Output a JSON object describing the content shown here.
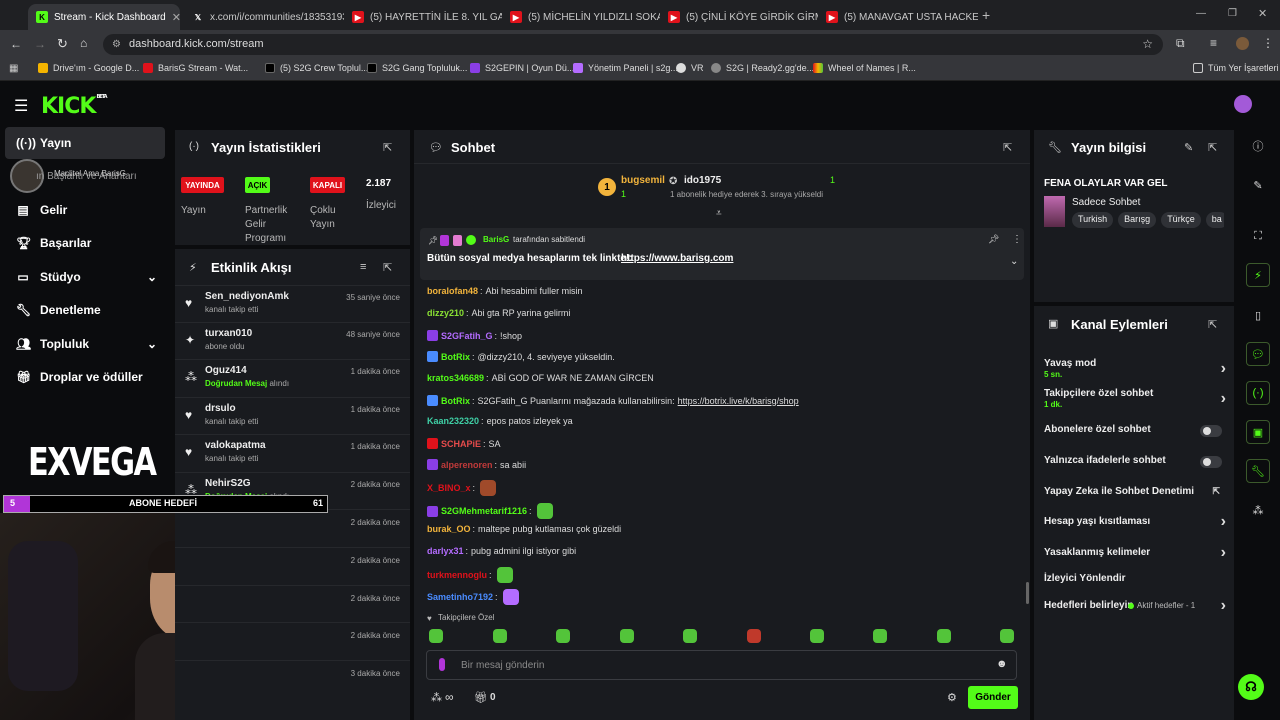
{
  "browser": {
    "tabs": [
      {
        "label": "Stream - Kick Dashboard",
        "icon": "kick"
      },
      {
        "label": "x.com/i/communities/18353193",
        "icon": "x"
      },
      {
        "label": "(5) HAYRETTİN İLE 8. YIL GALAS",
        "icon": "youtube"
      },
      {
        "label": "(5) MİCHELİN YILDIZLI SOKAK L",
        "icon": "youtube"
      },
      {
        "label": "(5) ÇİNLİ KÖYE GİRDİK GİRMEZ",
        "icon": "youtube"
      },
      {
        "label": "(5) MANAVGAT USTA HACKERL",
        "icon": "youtube"
      }
    ],
    "url": "dashboard.kick.com/stream",
    "bookmarks": [
      "Drive'ım - Google D...",
      "BarisG Stream - Wat...",
      "(5) S2G Crew Toplul...",
      "S2G Gang Topluluk...",
      "S2GEPIN | Oyun Dü...",
      "Yönetim Paneli | s2g...",
      "VR",
      "S2G | Ready2.gg'de...",
      "Wheel of Names | R..."
    ],
    "all_bookmarks": "Tüm Yer İşaretleri"
  },
  "kick": {
    "logo": "KICK",
    "logo_tag": "BETA"
  },
  "sidebar": {
    "items": [
      {
        "label": "Yayın",
        "icon": "broadcast-icon"
      },
      {
        "label": "Gelir",
        "icon": "chart-icon"
      },
      {
        "label": "Başarılar",
        "icon": "trophy-icon"
      },
      {
        "label": "Stüdyo",
        "icon": "studio-icon"
      },
      {
        "label": "Denetleme",
        "icon": "wrench-icon"
      },
      {
        "label": "Topluluk",
        "icon": "people-icon"
      },
      {
        "label": "Droplar ve ödüller",
        "icon": "gift-icon"
      }
    ],
    "overlap_text": "ın Başlantı ve Anahtarı",
    "overlay_name": "Maclitel Ama BarisG",
    "brand": "EXVEGA",
    "goal_label": "ABONE HEDEFİ",
    "goal_current": "5",
    "goal_target": "61",
    "goal_progress": 0.08
  },
  "stats": {
    "title": "Yayın İstatistikleri",
    "badges": [
      {
        "value": "YAYINDA",
        "label": "Yayın",
        "color": "#e0121b"
      },
      {
        "value": "AÇIK",
        "label": "Partnerlik Gelir Programı",
        "color": "#53fc18"
      },
      {
        "value": "KAPALI",
        "label": "Çoklu Yayın",
        "color": "#e0121b"
      },
      {
        "value": "2.187",
        "label": "İzleyici"
      }
    ]
  },
  "activity": {
    "title": "Etkinlik Akışı",
    "events": [
      {
        "name": "Sen_nediyonAmk",
        "sub": "kanalı takip etti",
        "time": "35 saniye önce",
        "icon": "heart-icon"
      },
      {
        "name": "turxan010",
        "sub": "abone oldu",
        "time": "48 saniye önce",
        "icon": "star-icon"
      },
      {
        "name": "Oguz414",
        "sub_hl": "Doğrudan Mesaj",
        "sub": "alındı",
        "time": "1 dakika önce",
        "icon": "points-icon"
      },
      {
        "name": "drsulo",
        "sub": "kanalı takip etti",
        "time": "1 dakika önce",
        "icon": "heart-icon"
      },
      {
        "name": "valokapatma",
        "sub": "kanalı takip etti",
        "time": "1 dakika önce",
        "icon": "heart-icon"
      },
      {
        "name": "NehirS2G",
        "sub_hl": "Doğrudan Mesaj",
        "sub": "alındı",
        "time": "2 dakika önce",
        "icon": "points-icon"
      },
      {
        "name": "",
        "sub": "",
        "time": "2 dakika önce"
      },
      {
        "name": "",
        "sub": "",
        "time": "2 dakika önce"
      },
      {
        "name": "",
        "sub": "",
        "time": "2 dakika önce"
      },
      {
        "name": "",
        "sub": "",
        "time": "2 dakika önce"
      },
      {
        "name": "",
        "sub": "",
        "time": "3 dakika önce"
      }
    ]
  },
  "chat": {
    "title": "Sohbet",
    "gift_top": {
      "user1": "bugsemil",
      "count1": "1",
      "user2": "ido1975",
      "count2": "1",
      "note": "1 abonelik hediye ederek 3. sıraya yükseldi"
    },
    "pinned_by": "BarisG",
    "pinned_suffix": "tarafından sabitlendi",
    "pinned_text": "Bütün sosyal medya hesaplarım tek linkte!:",
    "pinned_link": "https://www.barisg.com",
    "messages": [
      {
        "user": "boralofan48",
        "color": "#f2b43c",
        "text": "Abi hesabimi fuller misin"
      },
      {
        "user": "dizzy210",
        "color": "#8ae234",
        "text": "Abi gta RP yarina gelirmi"
      },
      {
        "user": "S2GFatih_G",
        "color": "#b46cff",
        "text": "!shop"
      },
      {
        "user": "BotRix",
        "color": "#53fc18",
        "text": "@dizzy210, 4. seviyeye yükseldin."
      },
      {
        "user": "kratos346689",
        "color": "#53fc18",
        "text": "ABİ GOD OF WAR NE ZAMAN GİRCEN"
      },
      {
        "user": "BotRix",
        "color": "#53fc18",
        "text": "S2GFatih_G Puanlarını mağazada kullanabilirsin:",
        "link": "https://botrix.live/k/barisg/shop"
      },
      {
        "user": "Kaan232320",
        "color": "#3fd0a6",
        "text": "epos patos izleyek ya"
      },
      {
        "user": "SCHAPiE",
        "color": "#e64b4b",
        "text": "SA"
      },
      {
        "user": "alperenoren",
        "color": "#c03a3a",
        "text": "sa abii"
      },
      {
        "user": "X_BINO_x",
        "color": "#e0121b",
        "text": ""
      },
      {
        "user": "S2GMehmetarif1216",
        "color": "#53fc18",
        "text": ""
      },
      {
        "user": "burak_OO",
        "color": "#f2b43c",
        "text": "maltepe pubg kutlaması çok güzeldi"
      },
      {
        "user": "darlyx31",
        "color": "#b46cff",
        "text": "pubg admini ilgi istiyor gibi"
      },
      {
        "user": "turkmennoglu",
        "color": "#e0121b",
        "text": ""
      },
      {
        "user": "Sametinho7192",
        "color": "#4a8cff",
        "text": ""
      }
    ],
    "followers_label": "Takipçilere Özel",
    "input_placeholder": "Bir mesaj gönderin",
    "points": "∞",
    "gift_count": "0",
    "send_label": "Gönder"
  },
  "stream_info": {
    "title": "Yayın bilgisi",
    "stream_title": "FENA OLAYLAR VAR GEL",
    "category": "Sadece Sohbet",
    "tags": [
      "Turkish",
      "Barışg",
      "Türkçe",
      "ba"
    ]
  },
  "channel_actions": {
    "title": "Kanal Eylemleri",
    "rows": [
      {
        "label": "Yavaş mod",
        "sub": "5 sn.",
        "type": "chevron"
      },
      {
        "label": "Takipçilere özel sohbet",
        "sub": "1 dk.",
        "type": "chevron"
      },
      {
        "label": "Abonelere özel sohbet",
        "type": "toggle"
      },
      {
        "label": "Yalnızca ifadelerle sohbet",
        "type": "toggle"
      },
      {
        "label": "Yapay Zeka ile Sohbet Denetimi",
        "type": "external"
      },
      {
        "label": "Hesap yaşı kısıtlaması",
        "type": "chevron"
      },
      {
        "label": "Yasaklanmış kelimeler",
        "type": "chevron"
      },
      {
        "label": "İzleyici Yönlendir",
        "type": "none"
      },
      {
        "label": "Hedefleri belirleyin",
        "sub_inline": "Aktif hedefler - 1",
        "type": "chevron"
      }
    ]
  }
}
